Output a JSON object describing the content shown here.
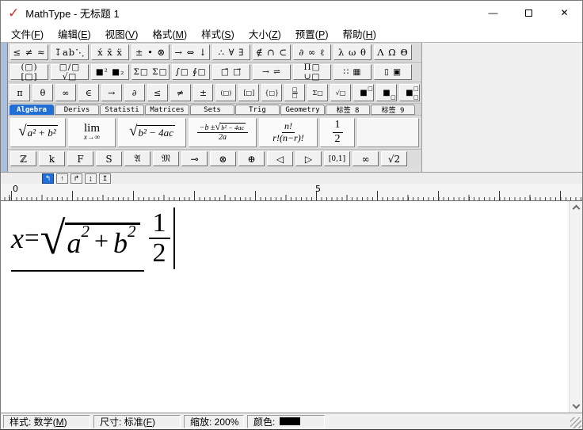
{
  "window": {
    "title": "MathType - 无标题 1",
    "logo_glyph": "✓",
    "minimize_glyph": "—",
    "close_glyph": "✕"
  },
  "menu": {
    "items": [
      "文件(F)",
      "编辑(E)",
      "视图(V)",
      "格式(M)",
      "样式(S)",
      "大小(Z)",
      "预置(P)",
      "帮助(H)"
    ]
  },
  "toolbar": {
    "symbol_palettes": [
      {
        "name": "relational-symbols",
        "icon": "≤ ≠ ≈"
      },
      {
        "name": "spaces-ellipses",
        "icon": "↧ab⋱"
      },
      {
        "name": "embellishments",
        "icon": "x́ x̄ ẍ"
      },
      {
        "name": "operator-symbols",
        "icon": "± • ⊗"
      },
      {
        "name": "arrow-symbols",
        "icon": "→ ⇔ ↓"
      },
      {
        "name": "logic-symbols",
        "icon": "∴ ∀ ∃"
      },
      {
        "name": "set-theory-symbols",
        "icon": "∉ ∩ ⊂"
      },
      {
        "name": "misc-symbols",
        "icon": "∂ ∞ ℓ"
      },
      {
        "name": "greek-lowercase",
        "icon": "λ ω θ"
      },
      {
        "name": "greek-uppercase",
        "icon": "Λ Ω Θ"
      }
    ],
    "template_palettes": [
      {
        "name": "fence-templates",
        "icon": "(□) [□]"
      },
      {
        "name": "fraction-radical-templates",
        "icon": "□/□ √□"
      },
      {
        "name": "subscript-superscript-templates",
        "icon": "■² ■₂"
      },
      {
        "name": "sum-templates",
        "icon": "Σ□ Σ□"
      },
      {
        "name": "integral-templates",
        "icon": "∫□ ∮□"
      },
      {
        "name": "underbar-overbar-templates",
        "icon": "□̄ □⃗"
      },
      {
        "name": "labeled-arrow-templates",
        "icon": "→ ⇌"
      },
      {
        "name": "product-set-templates",
        "icon": "Π□ ∪□"
      },
      {
        "name": "matrix-templates",
        "icon": "∷ ▦"
      },
      {
        "name": "box-templates",
        "icon": "▯ ▣"
      }
    ],
    "small_bar": {
      "items": [
        "π",
        "θ",
        "∞",
        "∈",
        "→",
        "∂",
        "≤",
        "≠",
        "±",
        "(□)",
        "[□]",
        "{□}"
      ],
      "fraction": {
        "num": "□",
        "den": "□"
      },
      "sum": "Σ□",
      "root": "√□",
      "script_base": "■",
      "script_slot": "□"
    },
    "tabs": [
      {
        "label": "Algebra",
        "selected": true
      },
      {
        "label": "Derivs"
      },
      {
        "label": "Statisti"
      },
      {
        "label": "Matrices"
      },
      {
        "label": "Sets"
      },
      {
        "label": "Trig"
      },
      {
        "label": "Geometry"
      },
      {
        "label": "标签 8"
      },
      {
        "label": "标签 9"
      }
    ],
    "templates": [
      {
        "name": "sqrt-a2-plus-b2",
        "radicand": "a² + b²"
      },
      {
        "name": "limit-x-to-infinity",
        "top": "lim",
        "bottom": "x→∞"
      },
      {
        "name": "sqrt-b2-minus-4ac",
        "radicand": "b² − 4ac"
      },
      {
        "name": "quadratic-formula",
        "num_pre": "−b ±",
        "num_radicand": "b² − 4ac",
        "den": "2a"
      },
      {
        "name": "binomial-ratio",
        "num": "n!",
        "den": "r!(n−r)!"
      },
      {
        "name": "one-half",
        "num": "1",
        "den": "2"
      }
    ],
    "user_bar": [
      {
        "name": "blackboard-z",
        "icon": "ℤ"
      },
      {
        "name": "letter-k",
        "icon": "k"
      },
      {
        "name": "letter-f",
        "icon": "F"
      },
      {
        "name": "letter-s",
        "icon": "S"
      },
      {
        "name": "fraktur-a",
        "icon": "𝔄"
      },
      {
        "name": "fraktur-m",
        "icon": "𝔐"
      },
      {
        "name": "multimap",
        "icon": "⊸"
      },
      {
        "name": "circled-times",
        "icon": "⊗"
      },
      {
        "name": "circled-plus",
        "icon": "⊕"
      },
      {
        "name": "triangle-left",
        "icon": "◁"
      },
      {
        "name": "triangle-right",
        "icon": "▷"
      },
      {
        "name": "interval-0-1",
        "icon": "[0,1]"
      },
      {
        "name": "infinity",
        "icon": "∞"
      },
      {
        "name": "sqrt-2",
        "icon": "√2"
      }
    ],
    "tab_stops": [
      {
        "name": "tab-left",
        "icon": "↰",
        "selected": true
      },
      {
        "name": "tab-center",
        "icon": "↑"
      },
      {
        "name": "tab-right",
        "icon": "↱"
      },
      {
        "name": "tab-relational",
        "icon": "↨"
      },
      {
        "name": "tab-decimal",
        "icon": "↥"
      }
    ]
  },
  "ruler": {
    "labels": [
      "0",
      "5"
    ]
  },
  "equation": {
    "lhs": "x",
    "equals": "=",
    "radicand_a": "a",
    "radicand_a_exp": "2",
    "radicand_op": "+",
    "radicand_b": "b",
    "radicand_b_exp": "2",
    "frac_num": "1",
    "frac_den": "2"
  },
  "status": {
    "style": "样式: 数学(M)",
    "size": "尺寸: 标准(F)",
    "zoom": "缩放: 200%",
    "color_label": "颜色:",
    "color_value": "#000000"
  },
  "colors": {
    "accent_tab": "#1f6fd6",
    "toolbar_strip": "#aabfdc",
    "logo": "#d32f2f"
  }
}
